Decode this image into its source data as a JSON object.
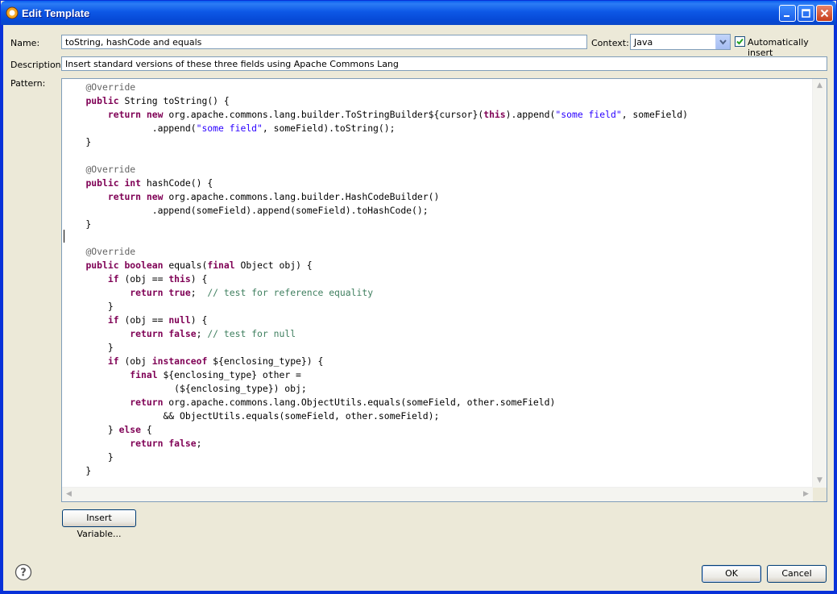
{
  "window": {
    "title": "Edit Template"
  },
  "form": {
    "name_label": "Name:",
    "name_value": "toString, hashCode and equals",
    "context_label": "Context:",
    "context_value": "Java",
    "auto_insert_label": "Automatically insert",
    "auto_insert_checked": true,
    "description_label": "Description:",
    "description_value": "Insert standard versions of these three fields using Apache Commons Lang",
    "pattern_label": "Pattern:"
  },
  "pattern_lines": [
    [
      {
        "t": "    "
      },
      {
        "c": "ann",
        "t": "@Override"
      }
    ],
    [
      {
        "t": "    "
      },
      {
        "c": "kw",
        "t": "public"
      },
      {
        "t": " String toString() {"
      }
    ],
    [
      {
        "t": "        "
      },
      {
        "c": "kw",
        "t": "return"
      },
      {
        "t": " "
      },
      {
        "c": "kw",
        "t": "new"
      },
      {
        "t": " org.apache.commons.lang.builder.ToStringBuilder${cursor}("
      },
      {
        "c": "kw",
        "t": "this"
      },
      {
        "t": ").append("
      },
      {
        "c": "str",
        "t": "\"some field\""
      },
      {
        "t": ", someField)"
      }
    ],
    [
      {
        "t": "                .append("
      },
      {
        "c": "str",
        "t": "\"some field\""
      },
      {
        "t": ", someField).toString();"
      }
    ],
    [
      {
        "t": "    }"
      }
    ],
    [
      {
        "t": ""
      }
    ],
    [
      {
        "t": "    "
      },
      {
        "c": "ann",
        "t": "@Override"
      }
    ],
    [
      {
        "t": "    "
      },
      {
        "c": "kw",
        "t": "public"
      },
      {
        "t": " "
      },
      {
        "c": "kw",
        "t": "int"
      },
      {
        "t": " hashCode() {"
      }
    ],
    [
      {
        "t": "        "
      },
      {
        "c": "kw",
        "t": "return"
      },
      {
        "t": " "
      },
      {
        "c": "kw",
        "t": "new"
      },
      {
        "t": " org.apache.commons.lang.builder.HashCodeBuilder()"
      }
    ],
    [
      {
        "t": "                .append(someField).append(someField).toHashCode();"
      }
    ],
    [
      {
        "t": "    }"
      }
    ],
    [
      {
        "t": ""
      }
    ],
    [
      {
        "t": "    "
      },
      {
        "c": "ann",
        "t": "@Override"
      }
    ],
    [
      {
        "t": "    "
      },
      {
        "c": "kw",
        "t": "public"
      },
      {
        "t": " "
      },
      {
        "c": "kw",
        "t": "boolean"
      },
      {
        "t": " equals("
      },
      {
        "c": "kw",
        "t": "final"
      },
      {
        "t": " Object obj) {"
      }
    ],
    [
      {
        "t": "        "
      },
      {
        "c": "kw",
        "t": "if"
      },
      {
        "t": " (obj == "
      },
      {
        "c": "kw",
        "t": "this"
      },
      {
        "t": ") {"
      }
    ],
    [
      {
        "t": "            "
      },
      {
        "c": "kw",
        "t": "return"
      },
      {
        "t": " "
      },
      {
        "c": "kw",
        "t": "true"
      },
      {
        "t": ";  "
      },
      {
        "c": "com",
        "t": "// test for reference equality"
      }
    ],
    [
      {
        "t": "        }"
      }
    ],
    [
      {
        "t": "        "
      },
      {
        "c": "kw",
        "t": "if"
      },
      {
        "t": " (obj == "
      },
      {
        "c": "kw",
        "t": "null"
      },
      {
        "t": ") {"
      }
    ],
    [
      {
        "t": "            "
      },
      {
        "c": "kw",
        "t": "return"
      },
      {
        "t": " "
      },
      {
        "c": "kw",
        "t": "false"
      },
      {
        "t": "; "
      },
      {
        "c": "com",
        "t": "// test for null"
      }
    ],
    [
      {
        "t": "        }"
      }
    ],
    [
      {
        "t": "        "
      },
      {
        "c": "kw",
        "t": "if"
      },
      {
        "t": " (obj "
      },
      {
        "c": "kw",
        "t": "instanceof"
      },
      {
        "t": " ${enclosing_type}) {"
      }
    ],
    [
      {
        "t": "            "
      },
      {
        "c": "kw",
        "t": "final"
      },
      {
        "t": " ${enclosing_type} other ="
      }
    ],
    [
      {
        "t": "                    (${enclosing_type}) obj;"
      }
    ],
    [
      {
        "t": "            "
      },
      {
        "c": "kw",
        "t": "return"
      },
      {
        "t": " org.apache.commons.lang.ObjectUtils.equals(someField, other.someField)"
      }
    ],
    [
      {
        "t": "                  && ObjectUtils.equals(someField, other.someField);"
      }
    ],
    [
      {
        "t": "        } "
      },
      {
        "c": "kw",
        "t": "else"
      },
      {
        "t": " {"
      }
    ],
    [
      {
        "t": "            "
      },
      {
        "c": "kw",
        "t": "return"
      },
      {
        "t": " "
      },
      {
        "c": "kw",
        "t": "false"
      },
      {
        "t": ";"
      }
    ],
    [
      {
        "t": "        }"
      }
    ],
    [
      {
        "t": "    }"
      }
    ]
  ],
  "buttons": {
    "insert_variable": "Insert Variable...",
    "ok": "OK",
    "cancel": "Cancel"
  },
  "icons": {
    "app": "eclipse-icon",
    "help": "help-icon",
    "minimize": "minimize-icon",
    "maximize": "maximize-icon",
    "close": "close-icon"
  },
  "colors": {
    "keyword": "#7f0055",
    "string": "#2a00ff",
    "comment": "#3f7f5f",
    "annotation": "#646464",
    "titlebar": "#0a5fef"
  }
}
